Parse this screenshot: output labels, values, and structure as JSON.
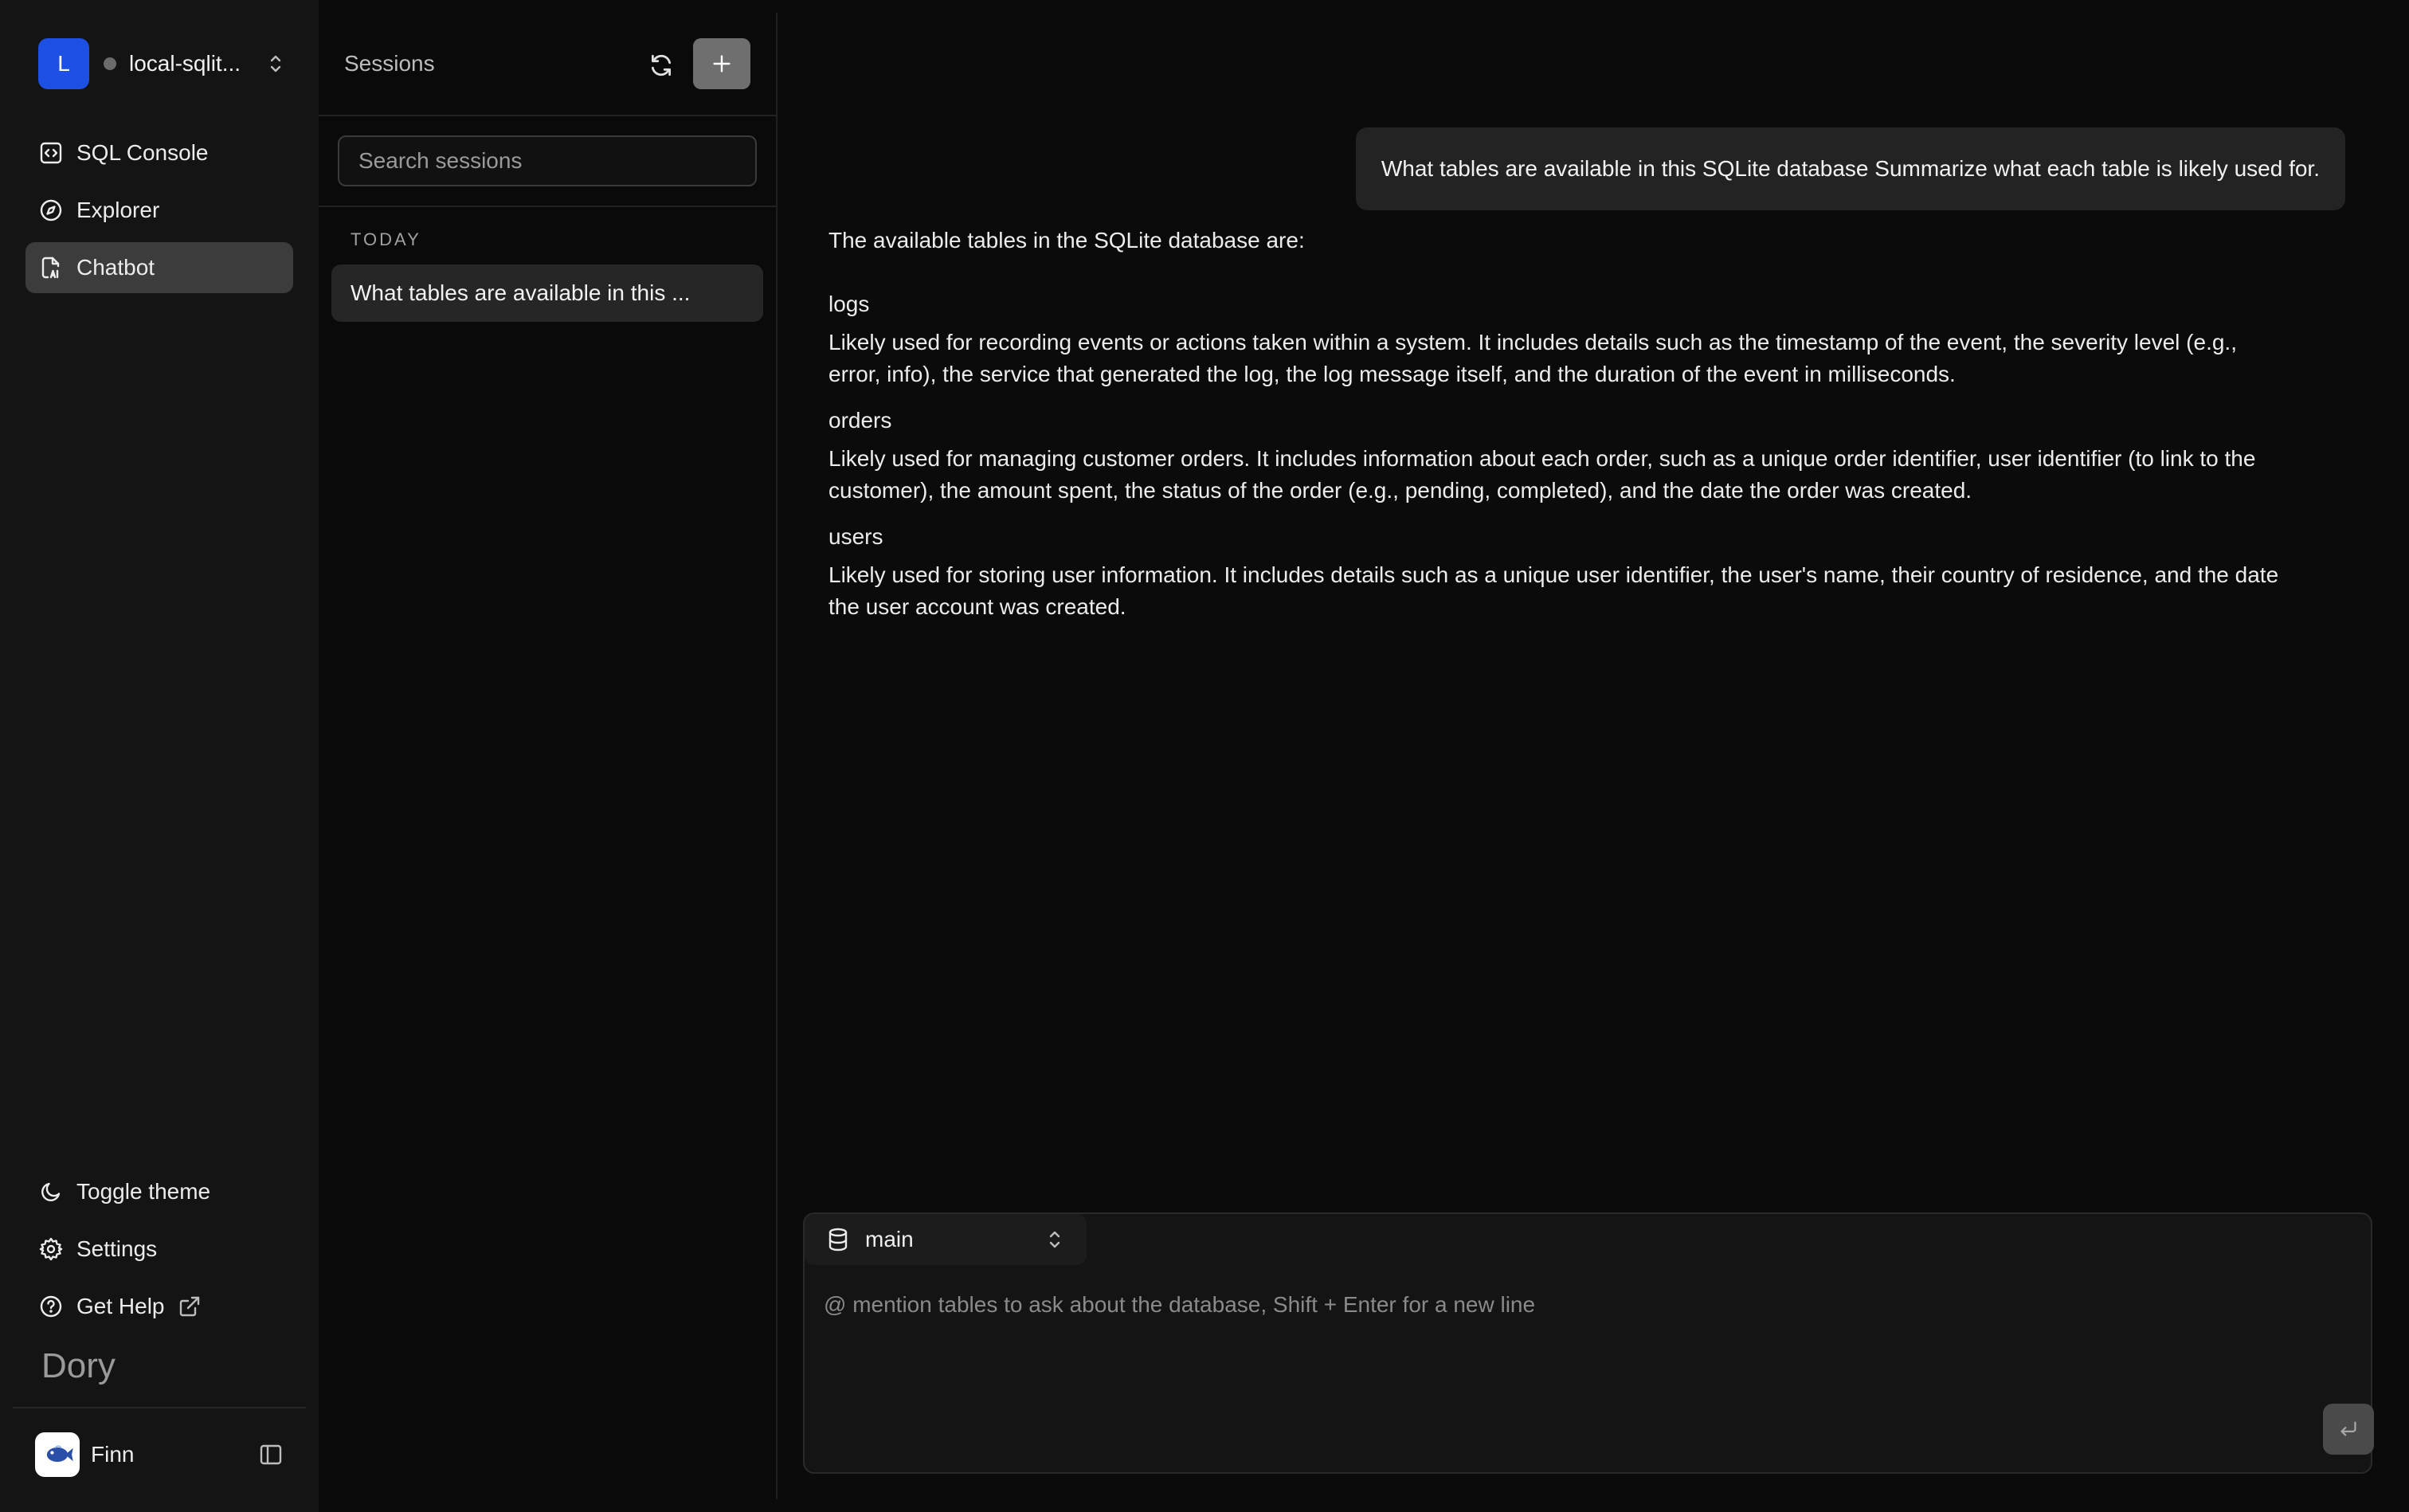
{
  "workspace": {
    "avatar_letter": "L",
    "name": "local-sqlit..."
  },
  "nav": {
    "items": [
      {
        "label": "SQL Console",
        "icon": "code-square-icon"
      },
      {
        "label": "Explorer",
        "icon": "compass-icon"
      },
      {
        "label": "Chatbot",
        "icon": "ai-file-icon",
        "active": true
      }
    ],
    "bottom": [
      {
        "label": "Toggle theme",
        "icon": "moon-icon"
      },
      {
        "label": "Settings",
        "icon": "gear-icon"
      },
      {
        "label": "Get Help",
        "icon": "help-circle-icon"
      }
    ],
    "brand": "Dory",
    "user": {
      "name": "Finn"
    }
  },
  "sessions": {
    "title": "Sessions",
    "search_placeholder": "Search sessions",
    "groups": [
      {
        "label": "TODAY",
        "items": [
          "What tables are available in this ..."
        ]
      }
    ]
  },
  "chat": {
    "user_message": "What tables are available in this SQLite database Summarize what each table is likely used for.",
    "answer": {
      "intro": "The available tables in the SQLite database are:",
      "tables": [
        {
          "name": "logs",
          "description": "Likely used for recording events or actions taken within a system. It includes details such as the timestamp of the event, the severity level (e.g., error, info), the service that generated the log, the log message itself, and the duration of the event in milliseconds."
        },
        {
          "name": "orders",
          "description": "Likely used for managing customer orders. It includes information about each order, such as a unique order identifier, user identifier (to link to the customer), the amount spent, the status of the order (e.g., pending, completed), and the date the order was created."
        },
        {
          "name": "users",
          "description": "Likely used for storing user information. It includes details such as a unique user identifier, the user's name, their country of residence, and the date the user account was created."
        }
      ]
    },
    "composer": {
      "schema": "main",
      "placeholder": "@ mention tables to ask about the database, Shift + Enter for a new line"
    }
  },
  "colors": {
    "accent": "#1f50e6",
    "active_nav": "#3c3c3c",
    "bubble": "#232323"
  }
}
